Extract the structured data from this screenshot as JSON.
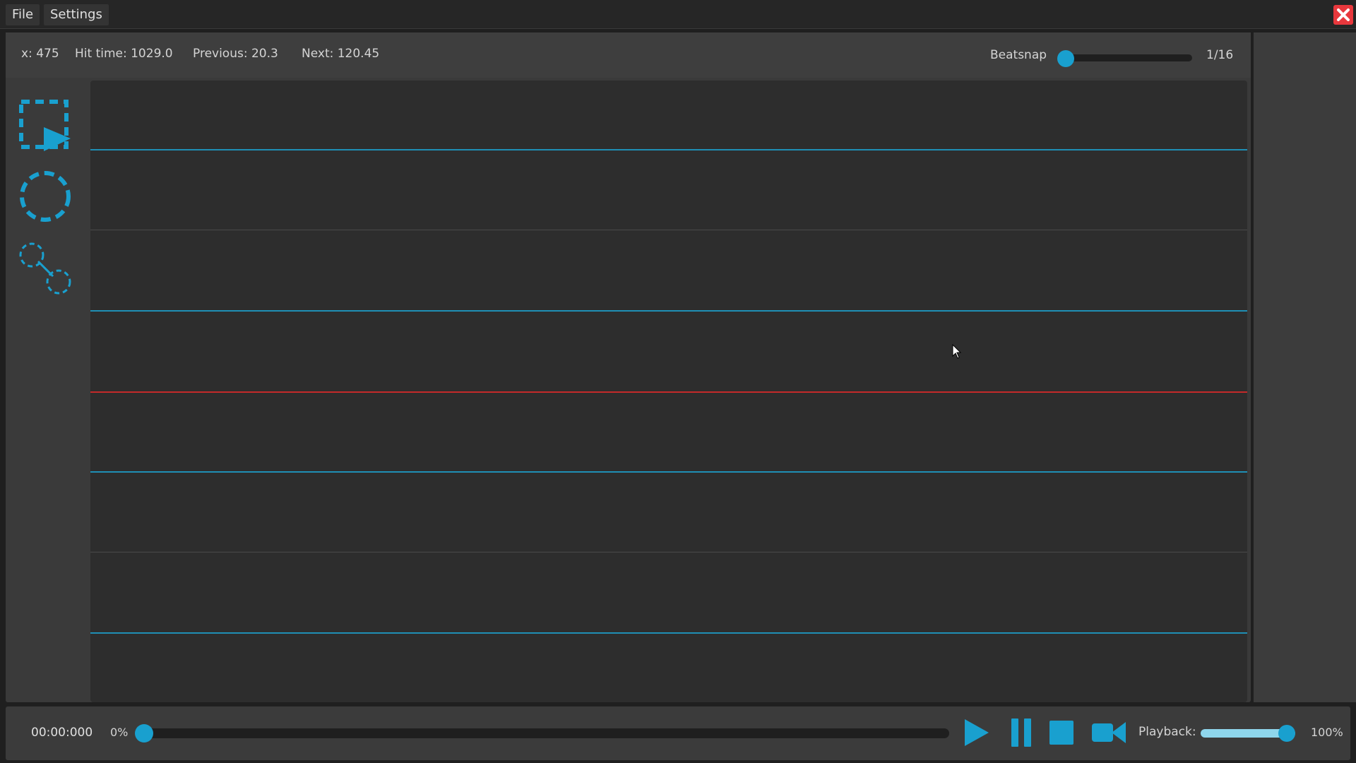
{
  "menu": {
    "file": "File",
    "settings": "Settings"
  },
  "info": {
    "x": "x: 475",
    "hit_time": "Hit time: 1029.0",
    "previous": "Previous: 20.3",
    "next": "Next: 120.45"
  },
  "beatsnap": {
    "label": "Beatsnap",
    "value": "1/16",
    "level": 0
  },
  "tools": [
    "select-tool-icon",
    "hit-circle-tool-icon",
    "slider-tool-icon"
  ],
  "timeline": {
    "line_order": [
      "blue",
      "gray",
      "blue",
      "red",
      "blue",
      "gray",
      "blue"
    ]
  },
  "transport": {
    "time": "00:00:000",
    "progress": "0%",
    "progress_level": 0,
    "playback_label": "Playback:",
    "playback_value": "100%",
    "playback_level": 1.0
  },
  "colors": {
    "accent": "#19a0cf",
    "timing_line": "#1f8fb5",
    "current_line": "#c42a2a",
    "close": "#e8383d"
  }
}
